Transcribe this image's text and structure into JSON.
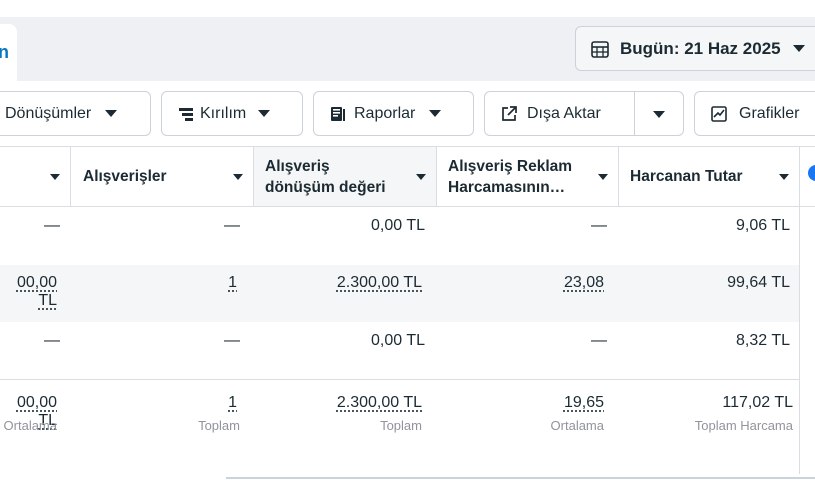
{
  "tab": {
    "partial_label": "n"
  },
  "date_button": {
    "label": "Bugün: 21 Haz 2025"
  },
  "toolbar": {
    "conversions": "Dönüşümler",
    "breakdown": "Kırılım",
    "reports": "Raporlar",
    "export": "Dışa Aktar",
    "charts": "Grafikler"
  },
  "columns": [
    {
      "label": ""
    },
    {
      "label": "Alışverişler"
    },
    {
      "label": "Alışveriş dönüşüm değeri"
    },
    {
      "label": "Alışveriş Reklam Harcamasının…"
    },
    {
      "label": "Harcanan Tutar"
    }
  ],
  "rows": [
    {
      "c0": "—",
      "c1": "—",
      "c2": "0,00 TL",
      "c3": "—",
      "c4": "9,06 TL"
    },
    {
      "c0": "00,00 TL",
      "c1": "1",
      "c2": "2.300,00 TL",
      "c3": "23,08",
      "c4": "99,64 TL"
    },
    {
      "c0": "—",
      "c1": "—",
      "c2": "0,00 TL",
      "c3": "—",
      "c4": "8,32 TL"
    }
  ],
  "totals": {
    "c0": "00,00 TL",
    "c0_sub": "Ortalama",
    "c1": "1",
    "c1_sub": "Toplam",
    "c2": "2.300,00 TL",
    "c2_sub": "Toplam",
    "c3": "19,65",
    "c3_sub": "Ortalama",
    "c4": "117,02 TL",
    "c4_sub": "Toplam Harcama"
  },
  "icons": {
    "calendar": "calendar-icon",
    "breakdown": "breakdown-icon",
    "reports": "reports-icon",
    "export": "export-icon",
    "charts": "chart-icon"
  },
  "colors": {
    "accent": "#0a78be",
    "border": "#cbd2d9",
    "row_alt": "#f5f6f7",
    "band": "#eef0f3"
  }
}
